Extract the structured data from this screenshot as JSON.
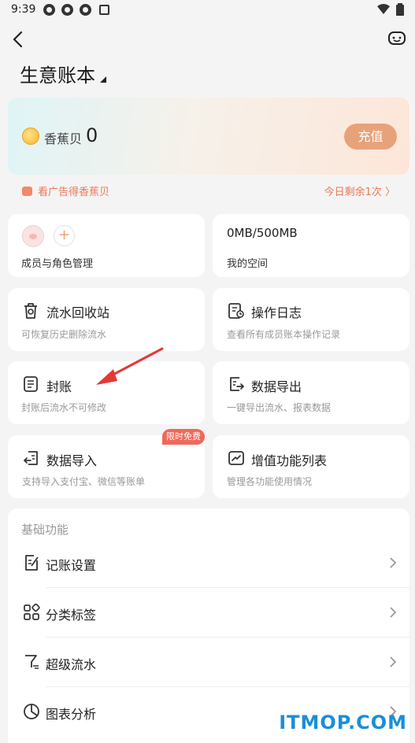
{
  "status": {
    "time": "9:39"
  },
  "header": {
    "book_title": "生意账本"
  },
  "banana": {
    "label": "香蕉贝",
    "value": "0",
    "recharge": "充值"
  },
  "ad": {
    "left": "看广告得香蕉贝",
    "right": "今日剩余1次 〉"
  },
  "cards": {
    "members": {
      "sub": "成员与角色管理"
    },
    "space": {
      "title": "0MB/500MB",
      "sub": "我的空间"
    },
    "recycle": {
      "title": "流水回收站",
      "sub": "可恢复历史删除流水"
    },
    "log": {
      "title": "操作日志",
      "sub": "查看所有成员账本操作记录"
    },
    "close": {
      "title": "封账",
      "sub": "封账后流水不可修改"
    },
    "export": {
      "title": "数据导出",
      "sub": "一键导出流水、报表数据"
    },
    "import": {
      "title": "数据导入",
      "sub": "支持导入支付宝、微信等账单",
      "badge": "限时免费"
    },
    "vas": {
      "title": "增值功能列表",
      "sub": "管理各功能使用情况"
    }
  },
  "basic": {
    "heading": "基础功能",
    "items": [
      {
        "label": "记账设置"
      },
      {
        "label": "分类标签"
      },
      {
        "label": "超级流水"
      },
      {
        "label": "图表分析"
      }
    ]
  },
  "watermark": {
    "text": "ITMOP.COM"
  },
  "colors": {
    "accent": "#e8a27a",
    "orange_text": "#e8795a",
    "badge": "#f0685a",
    "arrow": "#e53935",
    "watermark": "#1a8fd8"
  }
}
